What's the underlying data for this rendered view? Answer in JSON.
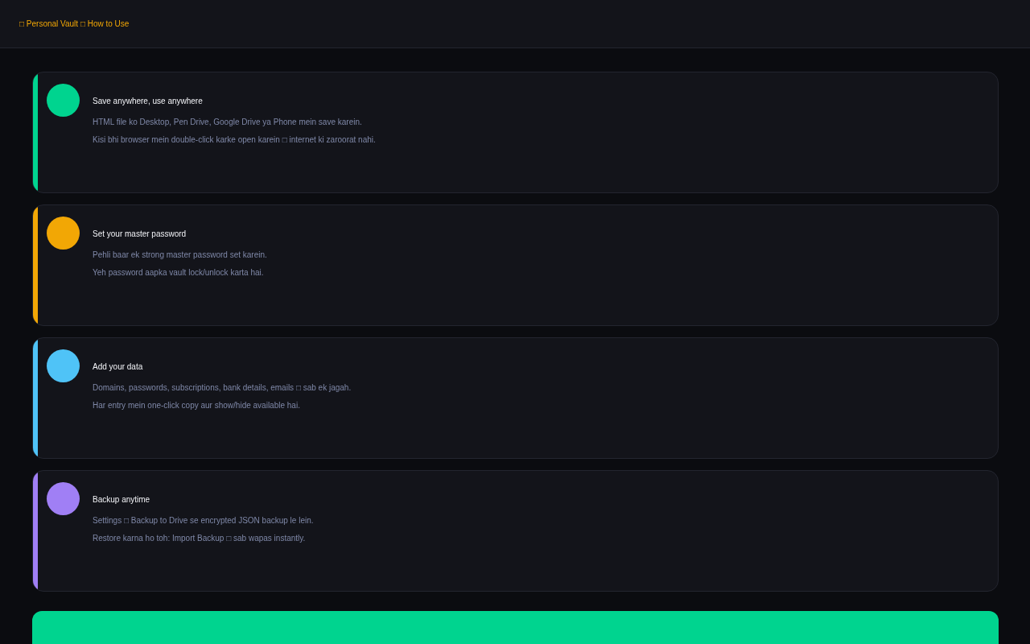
{
  "header": {
    "breadcrumb": "□ Personal Vault □ How to Use"
  },
  "steps": [
    {
      "title": "Save anywhere, use anywhere",
      "color": "#00d48f",
      "lines": [
        "HTML file ko Desktop, Pen Drive, Google Drive ya Phone mein save karein.",
        "Kisi bhi browser mein double-click karke open karein □ internet ki zaroorat nahi."
      ]
    },
    {
      "title": "Set your master password",
      "color": "#f2a705",
      "lines": [
        "Pehli baar ek strong master password set karein.",
        "Yeh password aapka vault lock/unlock karta hai."
      ]
    },
    {
      "title": "Add your data",
      "color": "#4fc3f7",
      "lines": [
        "Domains, passwords, subscriptions, bank details, emails □ sab ek jagah.",
        "Har entry mein one-click copy aur show/hide available hai."
      ]
    },
    {
      "title": "Backup anytime",
      "color": "#a07ff5",
      "lines": [
        "Settings □ Backup to Drive se encrypted JSON backup le lein.",
        "Restore karna ho toh: Import Backup □ sab wapas instantly."
      ]
    }
  ]
}
